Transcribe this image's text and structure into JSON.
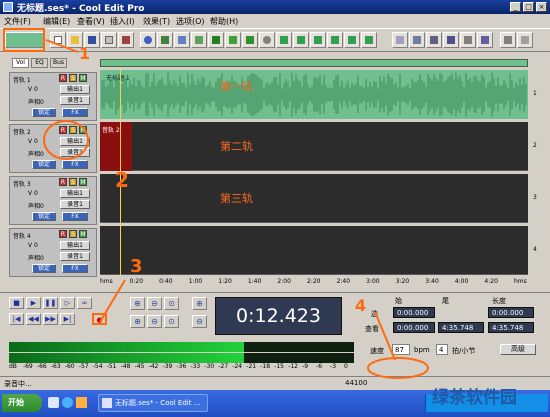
{
  "window": {
    "title": "无标题.ses* - Cool Edit Pro",
    "controls": [
      "_",
      "□",
      "×"
    ]
  },
  "menu": [
    "文件(F)",
    "编辑(E)",
    "查看(V)",
    "插入(I)",
    "效果(T)",
    "选项(O)",
    "帮助(H)"
  ],
  "view_tabs": [
    "Vol",
    "EQ",
    "Bus"
  ],
  "tracks": [
    {
      "name": "音轨 1",
      "r": "R",
      "s": "S",
      "m": "M",
      "vol": "V 0",
      "pan": "声相0",
      "out": "输出1",
      "rec": "录音1",
      "lock": "锁定",
      "fx": "FX",
      "lane_label": "第一轨",
      "clip": "无标题 1",
      "num": "1"
    },
    {
      "name": "音轨 2",
      "r": "R",
      "s": "S",
      "m": "M",
      "vol": "V 0",
      "pan": "声相0",
      "out": "输出1",
      "rec": "录音1",
      "lock": "锁定",
      "fx": "FX",
      "lane_label": "第二轨",
      "clip": "音轨 2",
      "num": "2"
    },
    {
      "name": "音轨 3",
      "r": "R",
      "s": "S",
      "m": "M",
      "vol": "V 0",
      "pan": "声相0",
      "out": "输出1",
      "rec": "录音1",
      "lock": "锁定",
      "fx": "FX",
      "lane_label": "第三轨",
      "clip": "",
      "num": "3"
    },
    {
      "name": "音轨 4",
      "r": "R",
      "s": "S",
      "m": "M",
      "vol": "V 0",
      "pan": "声相0",
      "out": "输出1",
      "rec": "录音1",
      "lock": "锁定",
      "fx": "FX",
      "lane_label": "",
      "clip": "",
      "num": "4"
    }
  ],
  "timeline_ticks": [
    "hms",
    "0:20",
    "0:40",
    "1:00",
    "1:20",
    "1:40",
    "2:00",
    "2:20",
    "2:40",
    "3:00",
    "3:20",
    "3:40",
    "4:00",
    "4:20",
    "hms"
  ],
  "transport": {
    "time_display": "0:12.423"
  },
  "info": {
    "headers": [
      "始",
      "尾",
      "长度"
    ],
    "row_labels": [
      "选",
      "查看"
    ],
    "selection": [
      "0:00.000",
      "",
      "0:00.000"
    ],
    "view": [
      "0:00.000",
      "4:35.748",
      "4:35.748"
    ]
  },
  "level_scale": [
    "dB",
    "-69",
    "-66",
    "-63",
    "-60",
    "-57",
    "-54",
    "-51",
    "-48",
    "-45",
    "-42",
    "-39",
    "-36",
    "-33",
    "-30",
    "-27",
    "-24",
    "-21",
    "-18",
    "-15",
    "-12",
    "-9",
    "-6",
    "-3",
    "0"
  ],
  "level_fraction": 0.68,
  "tempo": {
    "label": "速度",
    "bpm_value": "87",
    "bpm_unit": "bpm",
    "beats_value": "4",
    "beats_unit": "拍/小节",
    "advanced_label": "高级"
  },
  "status": {
    "left": "录音中...",
    "right": "44100"
  },
  "taskbar": {
    "start": "开始",
    "task": "无标题.ses* - Cool Edit ..."
  },
  "annotations": [
    "1",
    "2",
    "3",
    "4"
  ],
  "watermark": "绿茶软件园",
  "colors": {
    "annotation": "#ff6a10",
    "waveform": "#6fbf8f",
    "clip_red": "#8a1010",
    "lane_bg": "#2c2c2c"
  }
}
